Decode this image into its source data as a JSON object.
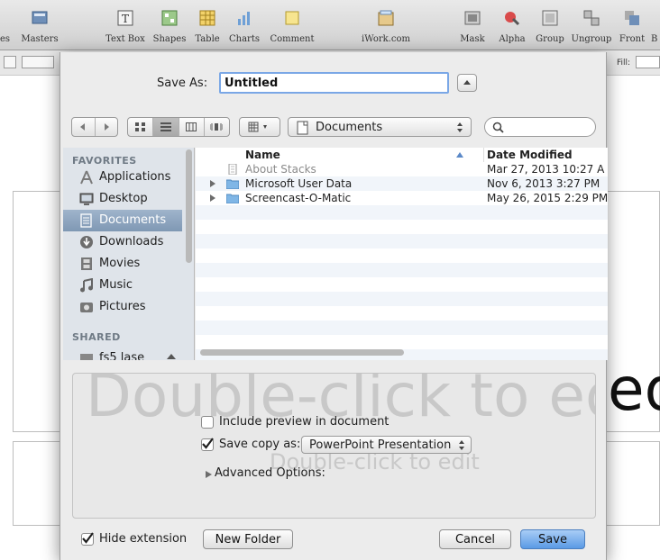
{
  "toolbar": {
    "items": [
      {
        "label": "es"
      },
      {
        "label": "Masters"
      },
      {
        "label": "Text Box"
      },
      {
        "label": "Shapes"
      },
      {
        "label": "Table"
      },
      {
        "label": "Charts"
      },
      {
        "label": "Comment"
      },
      {
        "label": "iWork.com"
      },
      {
        "label": "Mask"
      },
      {
        "label": "Alpha"
      },
      {
        "label": "Group"
      },
      {
        "label": "Ungroup"
      },
      {
        "label": "Front"
      },
      {
        "label": "B"
      }
    ]
  },
  "format_bar": {
    "fill_label": "Fill:"
  },
  "slide": {
    "title_placeholder": "Double-click to ed",
    "body_placeholder": "Double-click to edit"
  },
  "dialog": {
    "save_as_label": "Save As:",
    "save_as_value": "Untitled",
    "location": "Documents",
    "sidebar": {
      "favorites_header": "FAVORITES",
      "shared_header": "SHARED",
      "favorites": [
        {
          "label": "Applications",
          "icon": "applications-icon"
        },
        {
          "label": "Desktop",
          "icon": "desktop-icon"
        },
        {
          "label": "Documents",
          "icon": "documents-icon",
          "selected": true
        },
        {
          "label": "Downloads",
          "icon": "downloads-icon"
        },
        {
          "label": "Movies",
          "icon": "movies-icon"
        },
        {
          "label": "Music",
          "icon": "music-icon"
        },
        {
          "label": "Pictures",
          "icon": "pictures-icon"
        }
      ],
      "shared": [
        {
          "label": "fs5 lase",
          "icon": "network-drive-icon"
        }
      ]
    },
    "columns": {
      "name": "Name",
      "date": "Date Modified"
    },
    "files": [
      {
        "name": "About Stacks",
        "date": "Mar 27, 2013 10:27 A",
        "type": "file"
      },
      {
        "name": "Microsoft User Data",
        "date": "Nov 6, 2013 3:27 PM",
        "type": "folder"
      },
      {
        "name": "Screencast-O-Matic",
        "date": "May 26, 2015 2:29 PM",
        "type": "folder"
      }
    ],
    "options": {
      "include_preview_label": "Include preview in document",
      "include_preview_checked": false,
      "save_copy_label": "Save copy as:",
      "save_copy_checked": true,
      "save_copy_format": "PowerPoint Presentation",
      "advanced_label": "Advanced Options:"
    },
    "hide_extension_label": "Hide extension",
    "hide_extension_checked": true,
    "new_folder_label": "New Folder",
    "cancel_label": "Cancel",
    "save_label": "Save"
  },
  "colors": {
    "accent": "#5a9ae5",
    "sidebar_bg": "#dfe4ea",
    "sidebar_selected": "#8aa3bf",
    "folder": "#7fb6e6"
  }
}
